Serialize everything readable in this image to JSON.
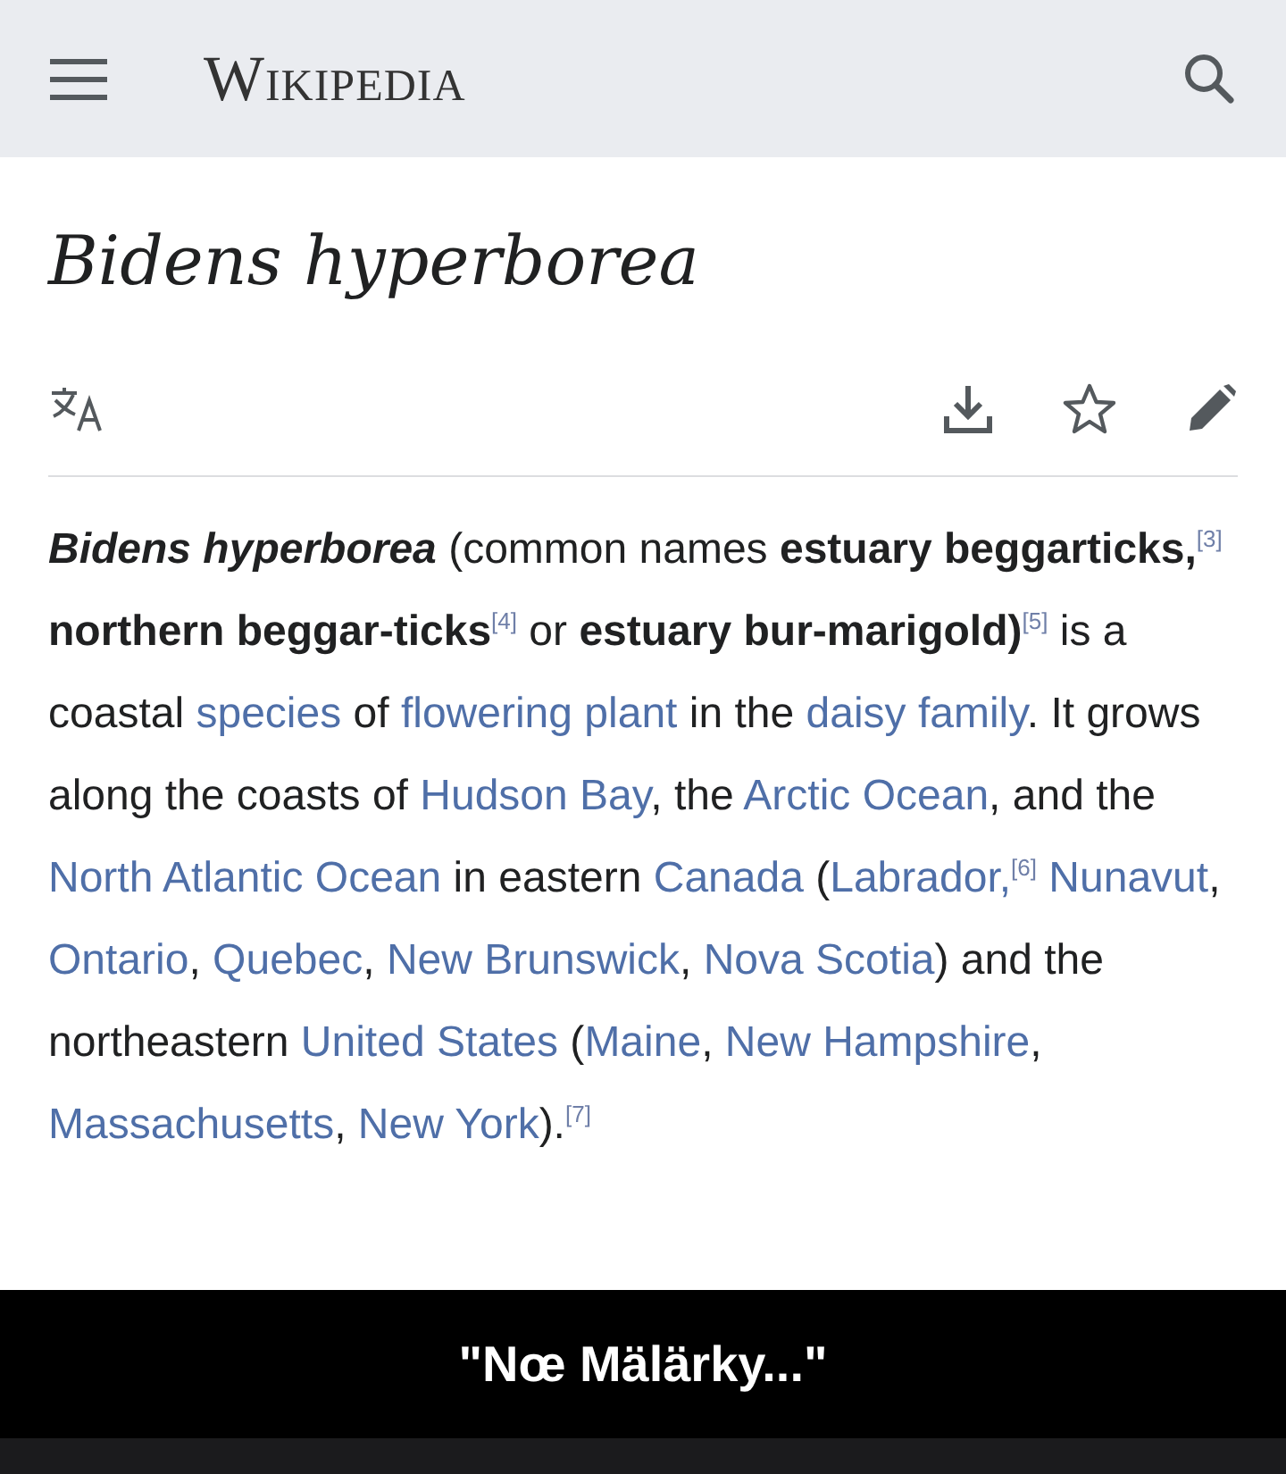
{
  "header": {
    "logo": "Wikipedia"
  },
  "article": {
    "title": "Bidens hyperborea",
    "paragraph": [
      {
        "kind": "bolditalic",
        "text": "Bidens hyperborea"
      },
      {
        "kind": "plain",
        "text": " (common names "
      },
      {
        "kind": "bold",
        "text": "estuary beggarticks,"
      },
      {
        "kind": "ref",
        "text": "[3]"
      },
      {
        "kind": "bold",
        "text": " northern beggar-ticks"
      },
      {
        "kind": "ref",
        "text": "[4]"
      },
      {
        "kind": "plain",
        "text": " or "
      },
      {
        "kind": "bold",
        "text": "estuary bur-marigold)"
      },
      {
        "kind": "ref",
        "text": "[5]"
      },
      {
        "kind": "plain",
        "text": " is a coastal "
      },
      {
        "kind": "link",
        "text": "species"
      },
      {
        "kind": "plain",
        "text": " of "
      },
      {
        "kind": "link",
        "text": "flowering plant"
      },
      {
        "kind": "plain",
        "text": " in the "
      },
      {
        "kind": "link",
        "text": "daisy family"
      },
      {
        "kind": "plain",
        "text": ". It grows along the coasts of "
      },
      {
        "kind": "link",
        "text": "Hudson Bay"
      },
      {
        "kind": "plain",
        "text": ", the "
      },
      {
        "kind": "link",
        "text": "Arctic Ocean"
      },
      {
        "kind": "plain",
        "text": ", and the "
      },
      {
        "kind": "link",
        "text": "North Atlantic Ocean"
      },
      {
        "kind": "plain",
        "text": " in eastern "
      },
      {
        "kind": "link",
        "text": "Canada"
      },
      {
        "kind": "plain",
        "text": " ("
      },
      {
        "kind": "link",
        "text": "Labrador,"
      },
      {
        "kind": "ref",
        "text": "[6]"
      },
      {
        "kind": "link",
        "text": " Nunavut"
      },
      {
        "kind": "plain",
        "text": ", "
      },
      {
        "kind": "link",
        "text": "Ontario"
      },
      {
        "kind": "plain",
        "text": ", "
      },
      {
        "kind": "link",
        "text": "Quebec"
      },
      {
        "kind": "plain",
        "text": ", "
      },
      {
        "kind": "link",
        "text": "New Brunswick"
      },
      {
        "kind": "plain",
        "text": ", "
      },
      {
        "kind": "link",
        "text": "Nova Scotia"
      },
      {
        "kind": "plain",
        "text": ") and the northeastern "
      },
      {
        "kind": "link",
        "text": "United States"
      },
      {
        "kind": "plain",
        "text": " ("
      },
      {
        "kind": "link",
        "text": "Maine"
      },
      {
        "kind": "plain",
        "text": ", "
      },
      {
        "kind": "link",
        "text": "New Hampshire"
      },
      {
        "kind": "plain",
        "text": ", "
      },
      {
        "kind": "link",
        "text": "Massachusetts"
      },
      {
        "kind": "plain",
        "text": ", "
      },
      {
        "kind": "link",
        "text": "New York"
      },
      {
        "kind": "plain",
        "text": ")."
      },
      {
        "kind": "ref",
        "text": "[7]"
      }
    ]
  },
  "caption": "\"Nœ Mälärky...\""
}
